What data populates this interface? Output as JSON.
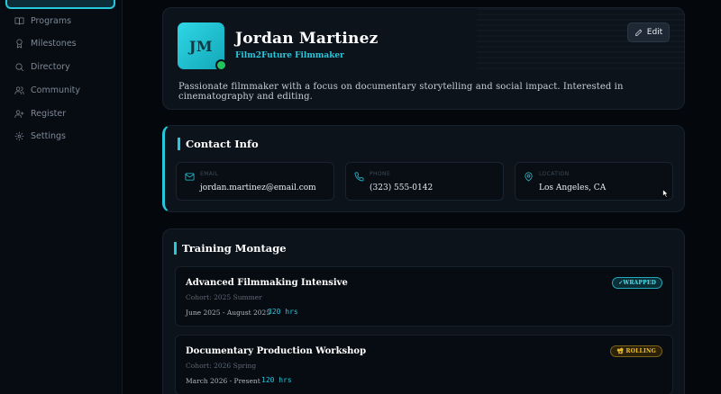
{
  "sidebar": {
    "items": [
      {
        "label": "Programs",
        "icon": "book-icon"
      },
      {
        "label": "Milestones",
        "icon": "award-icon"
      },
      {
        "label": "Directory",
        "icon": "search-icon"
      },
      {
        "label": "Community",
        "icon": "users-icon"
      },
      {
        "label": "Register",
        "icon": "user-plus-icon"
      },
      {
        "label": "Settings",
        "icon": "gear-icon"
      }
    ]
  },
  "profile": {
    "initials": "JM",
    "name": "Jordan Martinez",
    "subtitle": "Film2Future Filmmaker",
    "bio": "Passionate filmmaker with a focus on documentary storytelling and social impact. Interested in cinematography and editing.",
    "edit_label": "Edit",
    "online": true
  },
  "contact": {
    "title": "Contact Info",
    "email": {
      "label": "EMAIL",
      "value": "jordan.martinez@email.com"
    },
    "phone": {
      "label": "PHONE",
      "value": "(323) 555-0142"
    },
    "location": {
      "label": "LOCATION",
      "value": "Los Angeles, CA"
    }
  },
  "training": {
    "title": "Training Montage",
    "programs": [
      {
        "title": "Advanced Filmmaking Intensive",
        "cohort": "Cohort: 2025 Summer",
        "dates": "June 2025 - August 2025",
        "hours": "320 hrs",
        "badge": "✓WRAPPED"
      },
      {
        "title": "Documentary Production Workshop",
        "cohort": "Cohort: 2026 Spring",
        "dates": "March 2026 - Present",
        "hours": "120 hrs",
        "badge": "📽 ROLLING"
      }
    ]
  },
  "colors": {
    "accent": "#27c7dc",
    "online": "#22c55e",
    "rolling": "#f0c233"
  }
}
